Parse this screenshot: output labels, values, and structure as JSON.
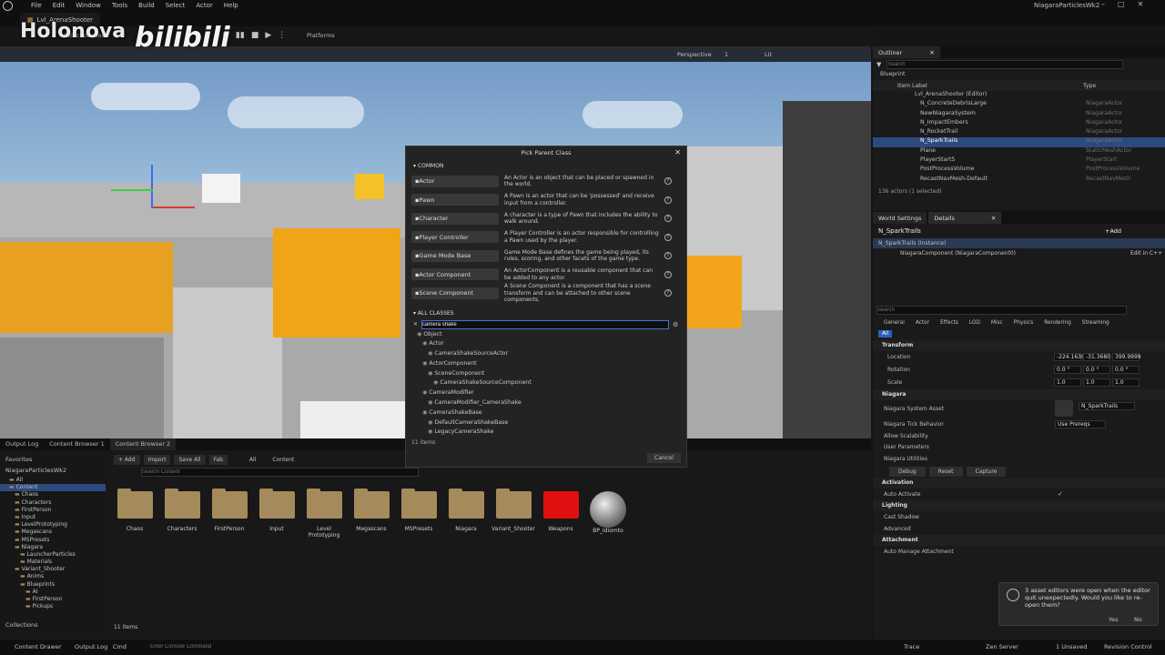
{
  "menubar": {
    "items": [
      "File",
      "Edit",
      "Window",
      "Tools",
      "Build",
      "Select",
      "Actor",
      "Help"
    ],
    "project": "NiagaraParticlesWk2"
  },
  "tabbar": {
    "level_tab": "Lvl_ArenaShooter"
  },
  "watermark": {
    "channel": "Holonova",
    "brand": "bilibili"
  },
  "toolbar": {
    "mode": "Selection Mode",
    "platforms": "Platforms"
  },
  "viewport": {
    "perspective": "Perspective",
    "lit": "Lit",
    "grid": "1"
  },
  "outliner": {
    "tab": "Outliner",
    "search_placeholder": "Search",
    "folder": "Blueprint",
    "col_label": "Item Label",
    "col_type": "Type",
    "rows": [
      {
        "name": "Lvl_ArenaShooter (Editor)",
        "type": ""
      },
      {
        "name": "N_ConcreteDebrisLarge",
        "type": "NiagaraActor"
      },
      {
        "name": "NewNiagaraSystem",
        "type": "NiagaraActor"
      },
      {
        "name": "N_ImpactEmbers",
        "type": "NiagaraActor"
      },
      {
        "name": "N_RocketTrail",
        "type": "NiagaraActor"
      },
      {
        "name": "N_SparkTrails",
        "type": "NiagaraActor"
      },
      {
        "name": "Plane",
        "type": "StaticMeshActor"
      },
      {
        "name": "PlayerStart5",
        "type": "PlayerStart"
      },
      {
        "name": "PostProcessVolume",
        "type": "PostProcessVolume"
      },
      {
        "name": "RecastNavMesh-Default",
        "type": "RecastNavMesh"
      }
    ],
    "count": "136 actors (1 selected)"
  },
  "details": {
    "tab_world": "World Settings",
    "tab_details": "Details",
    "actor_name": "N_SparkTrails",
    "add": "+Add",
    "instance": "N_SparkTrails (Instance)",
    "component": "NiagaraComponent (NiagaraComponent0)",
    "edit_cpp": "Edit in C++",
    "search_placeholder": "Search",
    "filters": [
      "General",
      "Actor",
      "Effects",
      "LOD",
      "Misc",
      "Physics",
      "Rendering",
      "Streaming"
    ],
    "all": "All",
    "sec_transform": "Transform",
    "location": "Location",
    "rotation": "Rotation",
    "scale": "Scale",
    "loc": [
      "-224.1630",
      "-31.3680",
      "399.9999"
    ],
    "rot": [
      "0.0 °",
      "0.0 °",
      "0.0 °"
    ],
    "scl": [
      "1.0",
      "1.0",
      "1.0"
    ],
    "sec_niagara": "Niagara",
    "system_asset": "Niagara System Asset",
    "system_asset_val": "N_SparkTrails",
    "tick": "Niagara Tick Behavior",
    "tick_val": "Use Prereqs",
    "allow_scal": "Allow Scalability",
    "user_params": "User Parameters",
    "utilities": "Niagara Utilities",
    "debug": "Debug",
    "reset": "Reset",
    "capture": "Capture",
    "sec_activation": "Activation",
    "auto_activate": "Auto Activate",
    "sec_lighting": "Lighting",
    "cast_shadow": "Cast Shadow",
    "advanced": "Advanced",
    "sec_attachment": "Attachment",
    "auto_manage": "Auto Manage Attachment"
  },
  "bottom": {
    "tabs": [
      "Output Log",
      "Content Browser 1",
      "Content Browser 2"
    ],
    "add": "+ Add",
    "import": "Import",
    "save_all": "Save All",
    "fab": "Fab",
    "path": [
      "All",
      "Content"
    ],
    "search_placeholder": "Search Content",
    "favorites": "Favorites",
    "project": "NiagaraParticlesWk2",
    "tree": [
      "All",
      "Content",
      "Chaos",
      "Characters",
      "FirstPerson",
      "Input",
      "LevelPrototyping",
      "Megascans",
      "MSPresets",
      "Niagara",
      "LauncherParticles",
      "Materials",
      "Variant_Shooter",
      "Anims",
      "Blueprints",
      "AI",
      "FirstPerson",
      "Pickups"
    ],
    "assets": [
      "Chaos",
      "Characters",
      "FirstPerson",
      "Input",
      "Level Prototyping",
      "Megascans",
      "MSPresets",
      "Niagara",
      "Variant_Shooter",
      "Weapons",
      "BP_Idiomto"
    ],
    "count": "11 items",
    "collections": "Collections"
  },
  "dialog": {
    "title": "Pick Parent Class",
    "common": "COMMON",
    "items": [
      {
        "label": "Actor",
        "desc": "An Actor is an object that can be placed or spawned in the world."
      },
      {
        "label": "Pawn",
        "desc": "A Pawn is an actor that can be 'possessed' and receive input from a controller."
      },
      {
        "label": "Character",
        "desc": "A character is a type of Pawn that includes the ability to walk around."
      },
      {
        "label": "Player Controller",
        "desc": "A Player Controller is an actor responsible for controlling a Pawn used by the player."
      },
      {
        "label": "Game Mode Base",
        "desc": "Game Mode Base defines the game being played, its rules, scoring, and other facets of the game type."
      },
      {
        "label": "Actor Component",
        "desc": "An ActorComponent is a reusable component that can be added to any actor."
      },
      {
        "label": "Scene Component",
        "desc": "A Scene Component is a component that has a scene transform and can be attached to other scene components."
      }
    ],
    "all_classes": "ALL CLASSES",
    "search_value": "camera shake",
    "classes": [
      {
        "name": "Object",
        "indent": 0
      },
      {
        "name": "Actor",
        "indent": 1
      },
      {
        "name": "CameraShakeSourceActor",
        "indent": 2
      },
      {
        "name": "ActorComponent",
        "indent": 1
      },
      {
        "name": "SceneComponent",
        "indent": 2
      },
      {
        "name": "CameraShakeSourceComponent",
        "indent": 3
      },
      {
        "name": "CameraModifier",
        "indent": 1
      },
      {
        "name": "CameraModifier_CameraShake",
        "indent": 2
      },
      {
        "name": "CameraShakeBase",
        "indent": 1
      },
      {
        "name": "DefaultCameraShakeBase",
        "indent": 2
      },
      {
        "name": "LegacyCameraShake",
        "indent": 2
      }
    ],
    "count": "11 items",
    "cancel": "Cancel"
  },
  "toast": {
    "message": "3 asset editors were open when the editor quit unexpectedly. Would you like to re-open them?",
    "yes": "Yes",
    "no": "No"
  },
  "statusbar": {
    "content_drawer": "Content Drawer",
    "output_log": "Output Log",
    "cmd": "Cmd",
    "console_placeholder": "Enter Console Command",
    "trace": "Trace",
    "zen": "Zen Server",
    "unsaved": "1 Unsaved",
    "revision": "Revision Control"
  }
}
